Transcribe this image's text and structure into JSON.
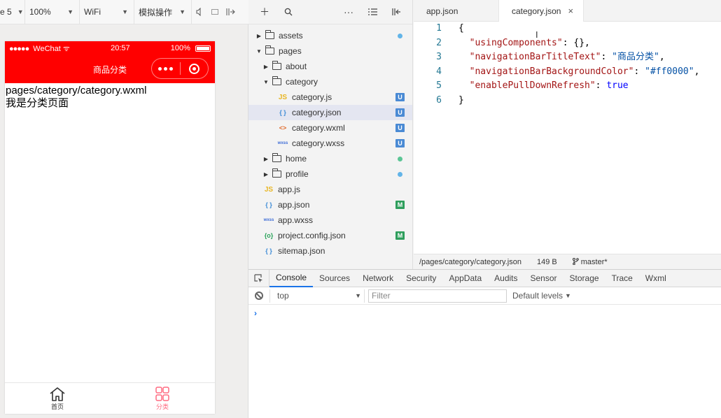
{
  "simulator": {
    "toolbar": {
      "device": "e 5",
      "zoom": "100%",
      "network": "WiFi",
      "mode": "模拟操作"
    },
    "status_bar": {
      "carrier": "WeChat",
      "time": "20:57",
      "battery": "100%"
    },
    "nav_bar": {
      "title": "商品分类",
      "background_color": "#ff0000"
    },
    "page": {
      "line1": "pages/category/category.wxml",
      "line2": "我是分类页面"
    },
    "tab_bar": {
      "items": [
        {
          "label": "首页",
          "icon": "home-icon",
          "color": "#333333"
        },
        {
          "label": "分类",
          "icon": "grid-icon",
          "color": "#ff6b81"
        }
      ]
    }
  },
  "explorer": {
    "tree": [
      {
        "label": "assets",
        "type": "folder",
        "open": false,
        "status": "dot-blue"
      },
      {
        "label": "pages",
        "type": "folder",
        "open": true,
        "status": ""
      },
      {
        "label": "about",
        "type": "folder",
        "open": false,
        "status": ""
      },
      {
        "label": "category",
        "type": "folder",
        "open": true,
        "status": ""
      },
      {
        "label": "category.js",
        "type": "js",
        "status": "U"
      },
      {
        "label": "category.json",
        "type": "json",
        "status": "U"
      },
      {
        "label": "category.wxml",
        "type": "wxml",
        "status": "U"
      },
      {
        "label": "category.wxss",
        "type": "wxss",
        "status": "U"
      },
      {
        "label": "home",
        "type": "folder",
        "open": false,
        "status": "dot-green"
      },
      {
        "label": "profile",
        "type": "folder",
        "open": false,
        "status": "dot-blue"
      },
      {
        "label": "app.js",
        "type": "js",
        "status": ""
      },
      {
        "label": "app.json",
        "type": "json",
        "status": "M"
      },
      {
        "label": "app.wxss",
        "type": "wxss",
        "status": ""
      },
      {
        "label": "project.config.json",
        "type": "config",
        "status": "M"
      },
      {
        "label": "sitemap.json",
        "type": "json",
        "status": ""
      }
    ],
    "icon_glyphs": {
      "js": "JS",
      "json": "{ }",
      "wxml": "<>",
      "wxss": "wxss",
      "config": "{o}"
    }
  },
  "editor": {
    "tabs": [
      {
        "label": "app.json",
        "active": false
      },
      {
        "label": "category.json",
        "active": true,
        "close": "×"
      }
    ],
    "lines": [
      {
        "n": "1",
        "text": "{"
      },
      {
        "n": "2",
        "key": "\"usingComponents\"",
        "sep": ": ",
        "val": "{}",
        "tail": ","
      },
      {
        "n": "3",
        "key": "\"navigationBarTitleText\"",
        "sep": ": ",
        "val": "\"商品分类\"",
        "tail": ","
      },
      {
        "n": "4",
        "key": "\"navigationBarBackgroundColor\"",
        "sep": ": ",
        "val": "\"#ff0000\"",
        "tail": ","
      },
      {
        "n": "5",
        "key": "\"enablePullDownRefresh\"",
        "sep": ": ",
        "val": "true",
        "tail": ""
      },
      {
        "n": "6",
        "text": "}"
      }
    ],
    "status": {
      "path": "/pages/category/category.json",
      "size": "149 B",
      "branch": "master*"
    }
  },
  "debugger": {
    "tabs": [
      "Console",
      "Sources",
      "Network",
      "Security",
      "AppData",
      "Audits",
      "Sensor",
      "Storage",
      "Trace",
      "Wxml"
    ],
    "active_tab": "Console",
    "context": "top",
    "filter_placeholder": "Filter",
    "levels": "Default levels",
    "prompt": "›"
  }
}
